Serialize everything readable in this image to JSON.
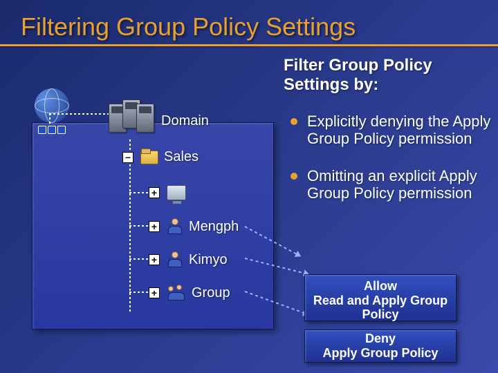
{
  "title": "Filtering Group Policy Settings",
  "subtitle": "Filter Group Policy Settings by:",
  "bullets": [
    "Explicitly denying the Apply Group Policy permission",
    "Omitting an explicit Apply Group Policy permission"
  ],
  "tree": {
    "domain_label": "Domain",
    "sales": "Sales",
    "mengph": "Mengph",
    "kimyo": "Kimyo",
    "group": "Group"
  },
  "perm": {
    "allow_line1": "Allow",
    "allow_line2": "Read and Apply Group",
    "allow_line3": "Policy",
    "deny_line1": "Deny",
    "deny_line2": "Apply Group Policy"
  }
}
